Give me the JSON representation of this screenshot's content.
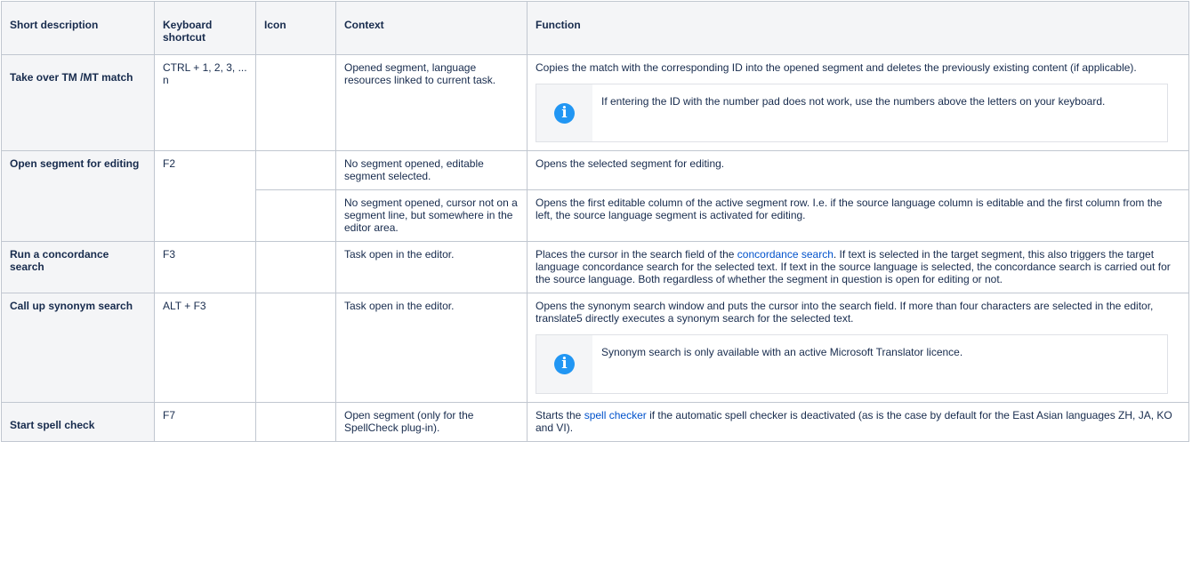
{
  "headers": {
    "short_description": "Short description",
    "keyboard_shortcut": "Keyboard shortcut",
    "icon": "Icon",
    "context": "Context",
    "function": "Function"
  },
  "rows": [
    {
      "description": "Take over TM /MT match",
      "shortcut": "CTRL + 1, 2, 3, ... n",
      "context": "Opened segment, language resources linked to current task.",
      "function": "Copies the match with the corresponding ID into the opened segment and deletes the previously existing content (if applicable).",
      "note": "If entering the ID with the number pad does not work, use the numbers above the letters on your keyboard."
    },
    {
      "description": "Open segment for editing",
      "shortcut": "F2",
      "context_1": "No segment opened, editable segment selected.",
      "function_1": "Opens the selected segment for editing.",
      "context_2": "No segment opened, cursor not on a segment line, but somewhere in the editor area.",
      "function_2": "Opens the first editable column of the active segment row. I.e. if the source language column is editable and the first column from the left, the source language segment is activated for editing."
    },
    {
      "description": "Run a concordance search",
      "shortcut": "F3",
      "context": "Task open in the editor.",
      "function_before": "Places the cursor in the search field of the ",
      "function_link": "concordance search",
      "function_after": ". If text is selected in the target segment, this also triggers the target language concordance search for the selected text. If text in the source language is selected, the concordance search is carried out for the source language. Both regardless of whether the segment in question is open for editing or not."
    },
    {
      "description": "Call up synonym search",
      "shortcut": "ALT + F3",
      "context": "Task open in the editor.",
      "function": "Opens the synonym search window and puts the cursor into the search field. If more than four characters are selected in the editor, translate5 directly executes a synonym search for the selected text.",
      "note": "Synonym search is only available with an active Microsoft Translator licence."
    },
    {
      "description": "Start spell check",
      "shortcut": "F7",
      "context": "Open segment (only for the SpellCheck plug-in).",
      "function_before": "Starts the ",
      "function_link": "spell checker",
      "function_after": " if the automatic spell checker is deactivated (as is the case by default for the East Asian languages ZH, JA, KO and VI)."
    }
  ],
  "icons": {
    "note": "info-icon",
    "glyph": "i"
  },
  "colors": {
    "link": "#0052cc",
    "info": "#2196f3",
    "header_bg": "#f4f5f7",
    "border": "#c1c7d0"
  }
}
